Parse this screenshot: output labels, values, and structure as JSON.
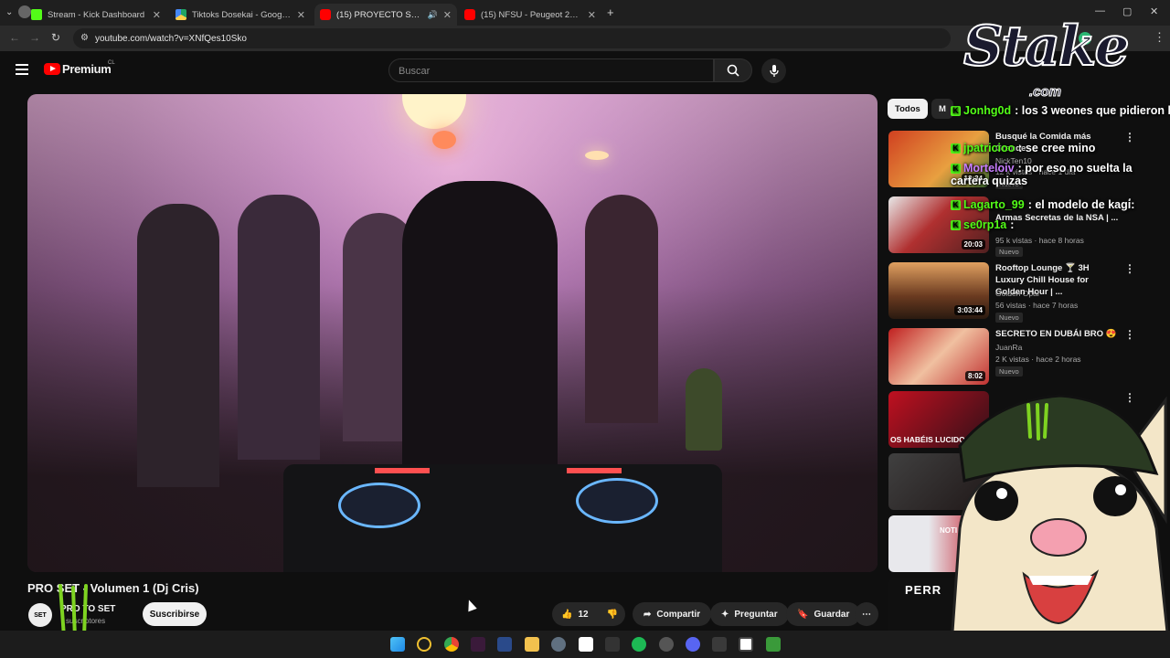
{
  "browser": {
    "tabs": [
      {
        "title": "Stream - Kick Dashboard",
        "color": "#53fc18"
      },
      {
        "title": "Tiktoks Dosekai - Google Drive",
        "color": "#1fa463"
      },
      {
        "title": "(15) PROYECTO SET - Volum",
        "color": "#ff0000"
      },
      {
        "title": "(15) NFSU - Peugeot 206 Tuning",
        "color": "#ff0000"
      }
    ],
    "url": "youtube.com/watch?v=XNfQes10Sko"
  },
  "youtube": {
    "logo_text": "Premium",
    "region": "CL",
    "search_placeholder": "Buscar"
  },
  "video": {
    "title": "PRO  SET - Volumen 1 (Dj Cris)",
    "channel_name": "PRO    TO SET",
    "subscribers": "suscriptores",
    "subscribe_label": "Suscribirse",
    "likes": "12",
    "share_label": "Compartir",
    "ask_label": "Preguntar",
    "save_label": "Guardar"
  },
  "sidebar": {
    "chip_all": "Todos",
    "chip_more": "M",
    "items": [
      {
        "title": "Busqué la Comida más Grande",
        "channel": "NickTen10",
        "meta": "12 k vistas · hace 1 día",
        "badge": "Nuevo",
        "duration": "12:34"
      },
      {
        "title": "Armas Secretas de la NSA | ...",
        "channel": "",
        "meta": "95 k vistas · hace 8 horas",
        "badge": "Nuevo",
        "duration": "20:03"
      },
      {
        "title": "Rooftop Lounge 🍸 3H Luxury Chill House for Golden Hour | ...",
        "channel": "Golden Opal",
        "meta": "56 vistas · hace 7 horas",
        "badge": "Nuevo",
        "duration": "3:03:44"
      },
      {
        "title": "SECRETO EN DUBÁI BRO 😍",
        "channel": "JuanRa",
        "meta": "2 K vistas · hace 2 horas",
        "badge": "Nuevo",
        "duration": "8:02"
      },
      {
        "title": "",
        "channel": "",
        "meta": "",
        "badge": "",
        "duration": "",
        "thumb_text": "OS HABÉIS LUCIDO"
      },
      {
        "title": "",
        "channel": "",
        "meta": "",
        "badge": "",
        "duration": ""
      },
      {
        "title": "",
        "channel": "",
        "meta": "",
        "badge": "",
        "duration": "",
        "thumb_text": "NOTI EN VIV"
      },
      {
        "title": "",
        "channel": "",
        "meta": "",
        "badge": "",
        "duration": "",
        "thumb_text": "PERR"
      }
    ]
  },
  "chat": [
    {
      "user": "Jonhg0d",
      "msg": "los 3 weones que pidieron kpop",
      "color": "#53fc18"
    },
    {
      "user": "jpatricioo",
      "msg": "se cree mino",
      "color": "#53fc18"
    },
    {
      "user": "Morteloiv",
      "msg": "por eso no suelta la cartera quizas",
      "color": "#c77dff"
    },
    {
      "user": "Lagarto_99",
      "msg": "el modelo de kagi:",
      "color": "#53fc18"
    },
    {
      "user": "se0rp1a",
      "msg": "",
      "color": "#53fc18"
    }
  ],
  "overlay": {
    "sponsor_logo": "Stake",
    "sponsor_domain": ".com"
  }
}
